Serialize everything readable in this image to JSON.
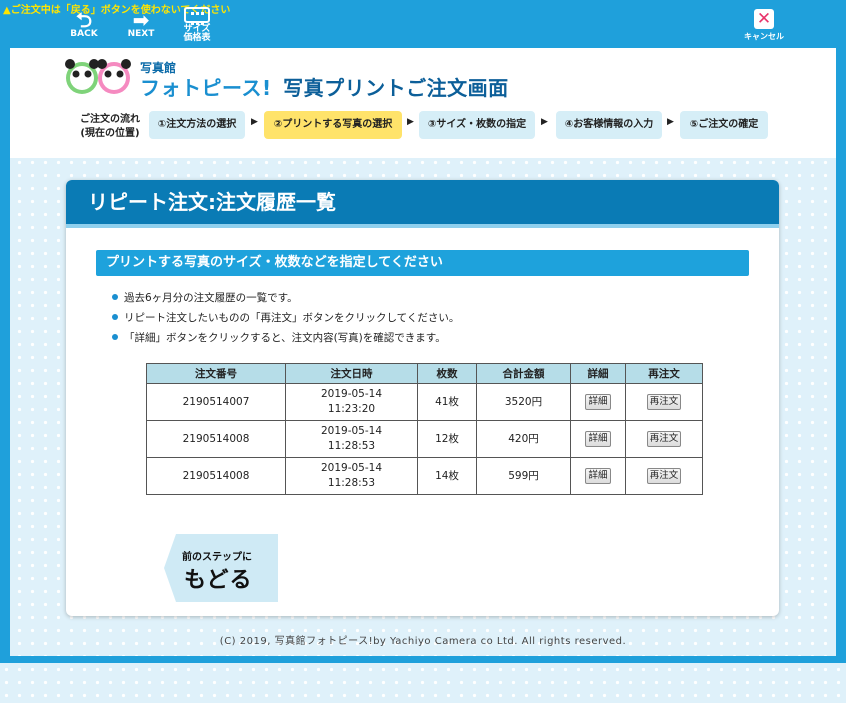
{
  "topbar": {
    "warning": "▲ご注文中は「戻る」ボタンを使わないでください",
    "back_label": "BACK",
    "next_label": "NEXT",
    "size_label_1": "サイズ",
    "size_label_2": "価格表",
    "cancel_label": "キャンセル",
    "back_icon": "back-arrow-icon",
    "next_icon": "next-arrow-icon",
    "size_icon": "price-table-icon",
    "cancel_icon": "close-icon"
  },
  "header": {
    "brand_small": "写真館",
    "brand_name": "フォトピース!",
    "brand_title": "写真プリントご注文画面",
    "flow_label_1": "ご注文の流れ",
    "flow_label_2": "(現在の位置)",
    "steps": [
      {
        "label": "①注文方法の選択"
      },
      {
        "label": "②プリントする写真の選択"
      },
      {
        "label": "③サイズ・枚数の指定"
      },
      {
        "label": "④お客様情報の入力"
      },
      {
        "label": "⑤ご注文の確定"
      }
    ],
    "active_step": 2
  },
  "panel": {
    "title": "リピート注文:注文履歴一覧",
    "subheading": "プリントする写真のサイズ・枚数などを指定してください",
    "bullets": [
      "過去6ヶ月分の注文履歴の一覧です。",
      "リピート注文したいものの「再注文」ボタンをクリックしてください。",
      "「詳細」ボタンをクリックすると、注文内容(写真)を確認できます。"
    ]
  },
  "table": {
    "headers": [
      "注文番号",
      "注文日時",
      "枚数",
      "合計金額",
      "詳細",
      "再注文"
    ],
    "rows": [
      {
        "order_no": "2190514007",
        "date": "2019-05-14",
        "time": "11:23:20",
        "count": "41枚",
        "total": "3520円",
        "detail": "詳細",
        "reorder": "再注文"
      },
      {
        "order_no": "2190514008",
        "date": "2019-05-14",
        "time": "11:28:53",
        "count": "12枚",
        "total": "420円",
        "detail": "詳細",
        "reorder": "再注文"
      },
      {
        "order_no": "2190514008",
        "date": "2019-05-14",
        "time": "11:28:53",
        "count": "14枚",
        "total": "599円",
        "detail": "詳細",
        "reorder": "再注文"
      }
    ]
  },
  "back_button": {
    "small": "前のステップに",
    "big": "もどる"
  },
  "footer": {
    "copyright": "(C) 2019, 写真館フォトピース!by Yachiyo Camera co Ltd. All rights reserved."
  },
  "colors": {
    "frame": "#1fa0db",
    "panel_header": "#0a7bb5",
    "subheading": "#1ea2dc",
    "active_step": "#ffe36a",
    "table_header": "#b6dde8",
    "warning_text": "#ffe500"
  }
}
